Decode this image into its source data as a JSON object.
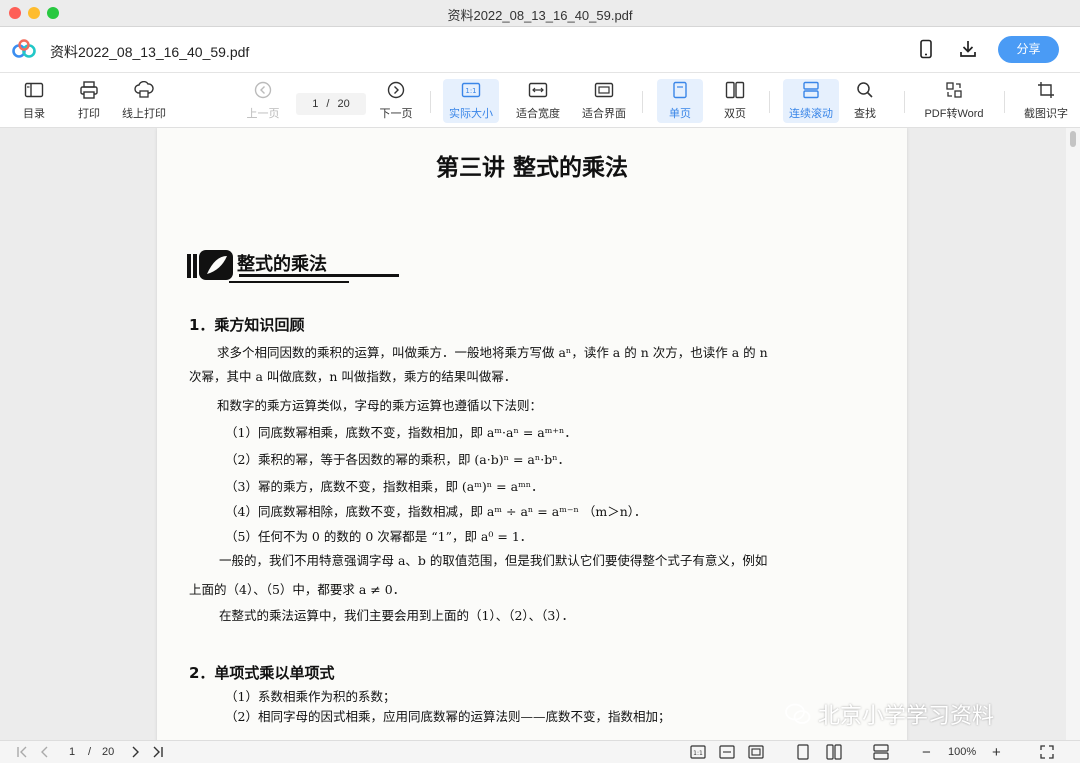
{
  "window": {
    "title": "资料2022_08_13_16_40_59.pdf"
  },
  "appbar": {
    "filename": "资料2022_08_13_16_40_59.pdf",
    "share_label": "分享"
  },
  "toolbar": {
    "toc": "目录",
    "print": "打印",
    "online_print": "线上打印",
    "prev": "上一页",
    "next": "下一页",
    "page_current": "1",
    "page_sep": "/",
    "page_total": "20",
    "actual_size": "实际大小",
    "fit_width": "适合宽度",
    "fit_page": "适合界面",
    "single_page": "单页",
    "double_page": "双页",
    "continuous": "连续滚动",
    "search": "查找",
    "pdf_to_word": "PDF转Word",
    "ocr": "截图识字"
  },
  "document": {
    "title": "第三讲  整式的乘法",
    "banner": "整式的乘法",
    "section1": "1．乘方知识回顾",
    "lines": [
      "求多个相同因数的乘积的运算，叫做乘方．一般地将乘方写做 aⁿ，读作 a 的 n 次方，也读作 a 的 n",
      "次幂，其中 a 叫做底数，n 叫做指数，乘方的结果叫做幂．",
      "和数字的乘方运算类似，字母的乘方运算也遵循以下法则：",
      "（1）同底数幂相乘，底数不变，指数相加，即 aᵐ·aⁿ = aᵐ⁺ⁿ．",
      "（2）乘积的幂，等于各因数的幂的乘积，即 (a·b)ⁿ = aⁿ·bⁿ．",
      "（3）幂的乘方，底数不变，指数相乘，即 (aᵐ)ⁿ = aᵐⁿ．",
      "（4）同底数幂相除，底数不变，指数相减，即 aᵐ ÷ aⁿ = aᵐ⁻ⁿ （m＞n）．",
      "（5）任何不为 0 的数的 0 次幂都是 “1”，即 a⁰ = 1．",
      "一般的，我们不用特意强调字母 a、b 的取值范围，但是我们默认它们要使得整个式子有意义，例如",
      "上面的（4）、（5）中，都要求 a ≠ 0．",
      "在整式的乘法运算中，我们主要会用到上面的（1）、（2）、（3）．"
    ],
    "section2": "2．单项式乘以单项式",
    "lines2": [
      "（1）系数相乘作为积的系数；",
      "（2）相同字母的因式相乘，应用同底数幂的运算法则——底数不变，指数相加；"
    ]
  },
  "watermark": "北京小学学习资料",
  "statusbar": {
    "page_current": "1",
    "page_sep": "/",
    "page_total": "20",
    "zoom": "100%",
    "zoom_out": "−",
    "zoom_in": "+"
  },
  "colors": {
    "accent": "#4a9bf5",
    "active_bg": "#e6f0fd"
  }
}
